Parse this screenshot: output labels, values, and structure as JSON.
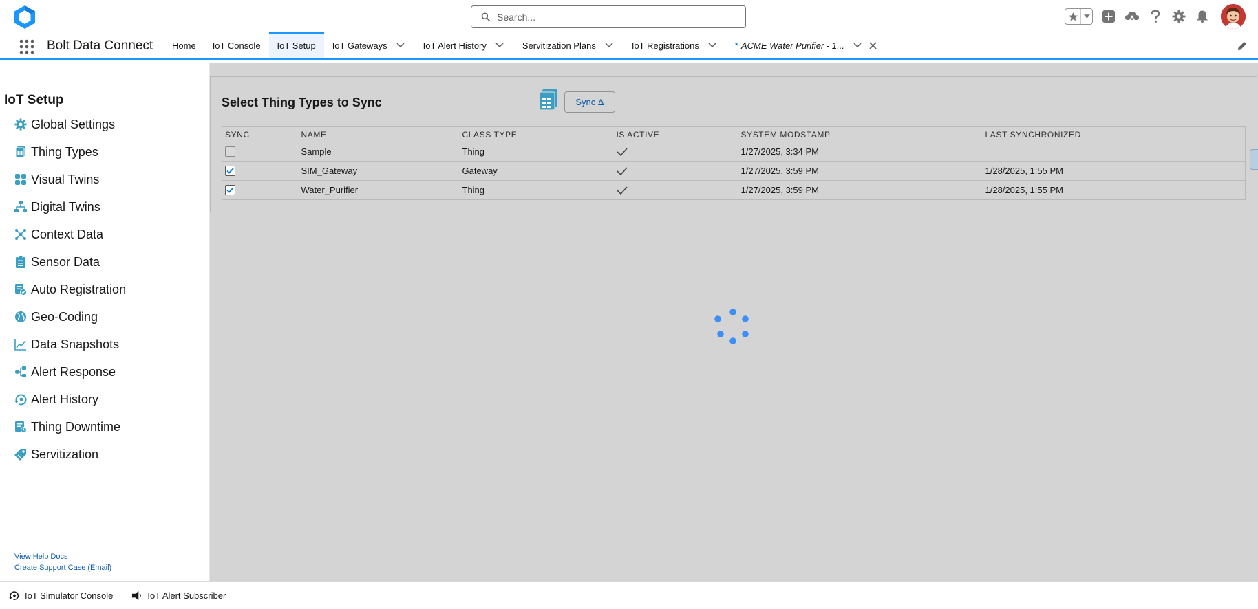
{
  "header": {
    "search_placeholder": "Search...",
    "icons": [
      "favorites-star-icon",
      "favorites-dropdown-icon",
      "global-add-icon",
      "trailhead-icon",
      "help-icon",
      "setup-gear-icon",
      "notifications-bell-icon",
      "user-avatar"
    ]
  },
  "nav": {
    "app_name": "Bolt Data Connect",
    "tabs": [
      {
        "label": "Home"
      },
      {
        "label": "IoT Console"
      },
      {
        "label": "IoT Setup",
        "active": true
      },
      {
        "label": "IoT Gateways",
        "has_dropdown": true
      },
      {
        "label": "IoT Alert History",
        "has_dropdown": true
      },
      {
        "label": "Servitization Plans",
        "has_dropdown": true
      },
      {
        "label": "IoT Registrations",
        "has_dropdown": true
      },
      {
        "label": "ACME Water Purifier - 1...",
        "unsaved_marker": "*",
        "has_dropdown": true,
        "closable": true
      }
    ]
  },
  "sidebar": {
    "title": "IoT Setup",
    "items": [
      {
        "label": "Global Settings",
        "icon": "gear-icon"
      },
      {
        "label": "Thing Types",
        "icon": "thing-types-icon"
      },
      {
        "label": "Visual Twins",
        "icon": "visual-twins-icon"
      },
      {
        "label": "Digital Twins",
        "icon": "hierarchy-icon"
      },
      {
        "label": "Context Data",
        "icon": "network-icon"
      },
      {
        "label": "Sensor Data",
        "icon": "clipboard-icon"
      },
      {
        "label": "Auto Registration",
        "icon": "auto-registration-icon"
      },
      {
        "label": "Geo-Coding",
        "icon": "geo-coding-icon"
      },
      {
        "label": "Data Snapshots",
        "icon": "line-chart-icon"
      },
      {
        "label": "Alert Response",
        "icon": "alert-response-icon"
      },
      {
        "label": "Alert History",
        "icon": "alert-history-icon"
      },
      {
        "label": "Thing Downtime",
        "icon": "downtime-icon"
      },
      {
        "label": "Servitization",
        "icon": "tag-icon"
      }
    ],
    "links": {
      "help": "View Help Docs",
      "support": "Create Support Case (Email)"
    }
  },
  "main": {
    "card_title": "Select Thing Types to Sync",
    "sync_button": "Sync Δ",
    "columns": [
      "SYNC",
      "NAME",
      "CLASS TYPE",
      "IS ACTIVE",
      "SYSTEM MODSTAMP",
      "LAST SYNCHRONIZED"
    ],
    "rows": [
      {
        "sync": false,
        "name": "Sample",
        "class_type": "Thing",
        "is_active": true,
        "modstamp": "1/27/2025, 3:34 PM",
        "last_sync": ""
      },
      {
        "sync": true,
        "name": "SIM_Gateway",
        "class_type": "Gateway",
        "is_active": true,
        "modstamp": "1/27/2025, 3:59 PM",
        "last_sync": "1/28/2025, 1:55 PM"
      },
      {
        "sync": true,
        "name": "Water_Purifier",
        "class_type": "Thing",
        "is_active": true,
        "modstamp": "1/27/2025, 3:59 PM",
        "last_sync": "1/28/2025, 1:55 PM"
      }
    ],
    "loading": true
  },
  "utility_bar": {
    "items": [
      {
        "label": "IoT Simulator Console",
        "icon": "simulator-icon"
      },
      {
        "label": "IoT Alert Subscriber",
        "icon": "alert-subscriber-icon"
      }
    ]
  },
  "colors": {
    "brand_blue": "#1b96ff",
    "link_blue": "#0b5cab",
    "icon_teal": "#3a9fc2",
    "overlay_gray": "#d4d4d4",
    "spinner_blue": "#3e8ef7"
  }
}
